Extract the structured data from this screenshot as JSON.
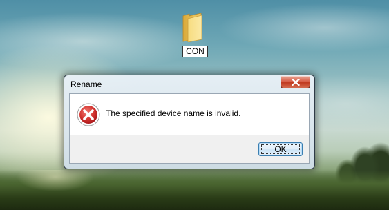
{
  "desktop": {
    "folder": {
      "label": "CON",
      "icon": "folder-icon"
    }
  },
  "dialog": {
    "title": "Rename",
    "close_icon": "close-icon",
    "message": "The specified device name is invalid.",
    "error_icon": "error-icon",
    "ok_label": "OK"
  },
  "colors": {
    "close_button": "#c0391f",
    "error_icon": "#c8262b",
    "ok_button_border": "#3c7fb1"
  }
}
